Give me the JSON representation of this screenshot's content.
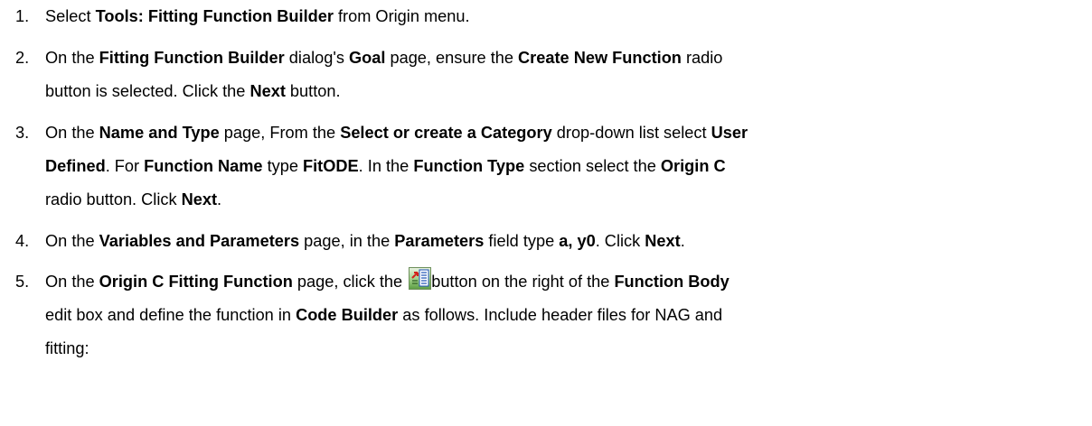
{
  "steps": [
    {
      "num": "1.",
      "lines": [
        [
          {
            "t": "Select ",
            "b": false
          },
          {
            "t": "Tools: Fitting Function Builder",
            "b": true
          },
          {
            "t": " from Origin menu.",
            "b": false
          }
        ]
      ]
    },
    {
      "num": "2.",
      "lines": [
        [
          {
            "t": "On the ",
            "b": false
          },
          {
            "t": "Fitting Function Builder",
            "b": true
          },
          {
            "t": " dialog's ",
            "b": false
          },
          {
            "t": "Goal",
            "b": true
          },
          {
            "t": " page, ensure the ",
            "b": false
          },
          {
            "t": "Create New Function",
            "b": true
          },
          {
            "t": " radio",
            "b": false
          }
        ],
        [
          {
            "t": "button is selected. Click the ",
            "b": false
          },
          {
            "t": "Next",
            "b": true
          },
          {
            "t": " button.",
            "b": false
          }
        ]
      ]
    },
    {
      "num": "3.",
      "lines": [
        [
          {
            "t": "On the ",
            "b": false
          },
          {
            "t": "Name and Type",
            "b": true
          },
          {
            "t": " page, From the ",
            "b": false
          },
          {
            "t": "Select or create a Category",
            "b": true
          },
          {
            "t": " drop-down list select ",
            "b": false
          },
          {
            "t": "User",
            "b": true
          }
        ],
        [
          {
            "t": "Defined",
            "b": true
          },
          {
            "t": ". For ",
            "b": false
          },
          {
            "t": "Function Name",
            "b": true
          },
          {
            "t": " type ",
            "b": false
          },
          {
            "t": "FitODE",
            "b": true
          },
          {
            "t": ". In the ",
            "b": false
          },
          {
            "t": "Function Type",
            "b": true
          },
          {
            "t": " section select the ",
            "b": false
          },
          {
            "t": "Origin C",
            "b": true
          }
        ],
        [
          {
            "t": "radio button. Click ",
            "b": false
          },
          {
            "t": "Next",
            "b": true
          },
          {
            "t": ".",
            "b": false
          }
        ]
      ]
    },
    {
      "num": "4.",
      "lines": [
        [
          {
            "t": "On the ",
            "b": false
          },
          {
            "t": "Variables and Parameters",
            "b": true
          },
          {
            "t": " page, in the ",
            "b": false
          },
          {
            "t": "Parameters",
            "b": true
          },
          {
            "t": " field type ",
            "b": false
          },
          {
            "t": "a, y0",
            "b": true
          },
          {
            "t": ". Click ",
            "b": false
          },
          {
            "t": "Next",
            "b": true
          },
          {
            "t": ".",
            "b": false
          }
        ]
      ]
    },
    {
      "num": "5.",
      "lines": [
        [
          {
            "t": "On the ",
            "b": false
          },
          {
            "t": "Origin C Fitting Function",
            "b": true
          },
          {
            "t": " page, click the ",
            "b": false
          },
          {
            "icon": "code-builder-icon"
          },
          {
            "t": "button on the right of the ",
            "b": false
          },
          {
            "t": "Function Body",
            "b": true
          }
        ],
        [
          {
            "t": "edit box and define the function in ",
            "b": false
          },
          {
            "t": "Code Builder",
            "b": true
          },
          {
            "t": " as follows. Include header files for NAG and",
            "b": false
          }
        ],
        [
          {
            "t": "fitting:",
            "b": false
          }
        ]
      ]
    }
  ]
}
